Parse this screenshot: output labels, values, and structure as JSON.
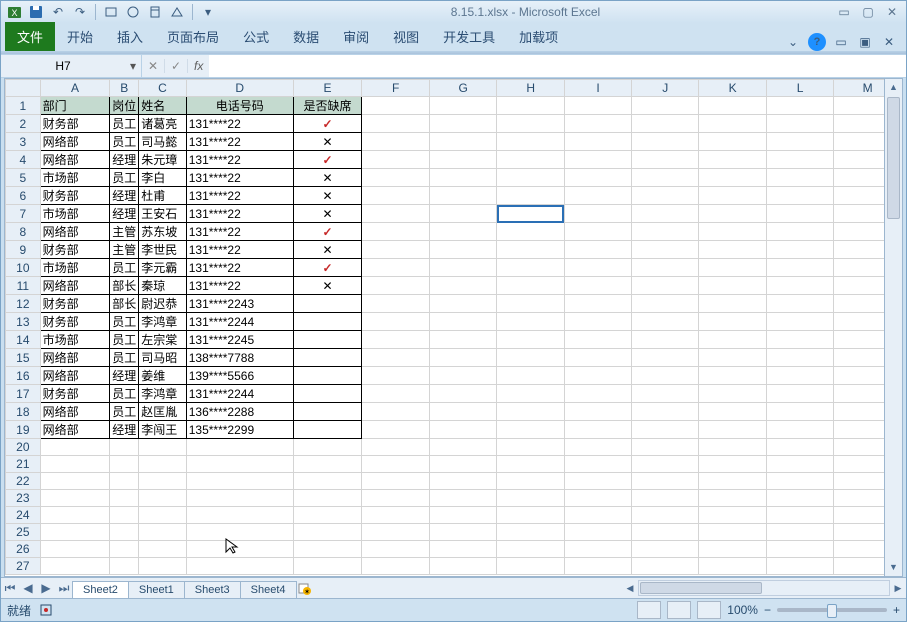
{
  "window_title": "8.15.1.xlsx - Microsoft Excel",
  "qat": {
    "undo": "↶",
    "redo": "↷"
  },
  "ribbon_tabs": {
    "file": "文件",
    "home": "开始",
    "insert": "插入",
    "layout": "页面布局",
    "formulas": "公式",
    "data": "数据",
    "review": "审阅",
    "view": "视图",
    "dev": "开发工具",
    "addin": "加载项"
  },
  "help_tooltip": "?",
  "namebox": "H7",
  "fx_label": "fx",
  "columns": [
    "A",
    "B",
    "C",
    "D",
    "E",
    "F",
    "G",
    "H",
    "I",
    "J",
    "K",
    "L",
    "M"
  ],
  "row_count": 27,
  "header_row": {
    "A": "部门",
    "B": "岗位",
    "C": "姓名",
    "D": "电话号码",
    "E": "是否缺席"
  },
  "data_rows": [
    {
      "A": "财务部",
      "B": "员工",
      "C": "诸葛亮",
      "D": "131****22",
      "E": "✓"
    },
    {
      "A": "网络部",
      "B": "员工",
      "C": "司马懿",
      "D": "131****22",
      "E": "✕"
    },
    {
      "A": "网络部",
      "B": "经理",
      "C": "朱元璋",
      "D": "131****22",
      "E": "✓"
    },
    {
      "A": "市场部",
      "B": "员工",
      "C": "李白",
      "D": "131****22",
      "E": "✕"
    },
    {
      "A": "财务部",
      "B": "经理",
      "C": "杜甫",
      "D": "131****22",
      "E": "✕"
    },
    {
      "A": "市场部",
      "B": "经理",
      "C": "王安石",
      "D": "131****22",
      "E": "✕"
    },
    {
      "A": "网络部",
      "B": "主管",
      "C": "苏东坡",
      "D": "131****22",
      "E": "✓"
    },
    {
      "A": "财务部",
      "B": "主管",
      "C": "李世民",
      "D": "131****22",
      "E": "✕"
    },
    {
      "A": "市场部",
      "B": "员工",
      "C": "李元霸",
      "D": "131****22",
      "E": "✓"
    },
    {
      "A": "网络部",
      "B": "部长",
      "C": "秦琼",
      "D": "131****22",
      "E": "✕"
    },
    {
      "A": "财务部",
      "B": "部长",
      "C": "尉迟恭",
      "D": "131****2243",
      "E": ""
    },
    {
      "A": "财务部",
      "B": "员工",
      "C": "李鸿章",
      "D": "131****2244",
      "E": ""
    },
    {
      "A": "市场部",
      "B": "员工",
      "C": "左宗棠",
      "D": "131****2245",
      "E": ""
    },
    {
      "A": "网络部",
      "B": "员工",
      "C": "司马昭",
      "D": "138****7788",
      "E": ""
    },
    {
      "A": "网络部",
      "B": "经理",
      "C": "姜维",
      "D": "139****5566",
      "E": ""
    },
    {
      "A": "财务部",
      "B": "员工",
      "C": "李鸿章",
      "D": "131****2244",
      "E": ""
    },
    {
      "A": "网络部",
      "B": "员工",
      "C": "赵匡胤",
      "D": "136****2288",
      "E": ""
    },
    {
      "A": "网络部",
      "B": "经理",
      "C": "李闯王",
      "D": "135****2299",
      "E": ""
    }
  ],
  "sheet_tabs": {
    "s2": "Sheet2",
    "s1": "Sheet1",
    "s3": "Sheet3",
    "s4": "Sheet4"
  },
  "active_sheet": "Sheet2",
  "status": {
    "ready": "就绪",
    "zoom": "100%"
  },
  "zoom_controls": {
    "minus": "−",
    "plus": "+"
  }
}
